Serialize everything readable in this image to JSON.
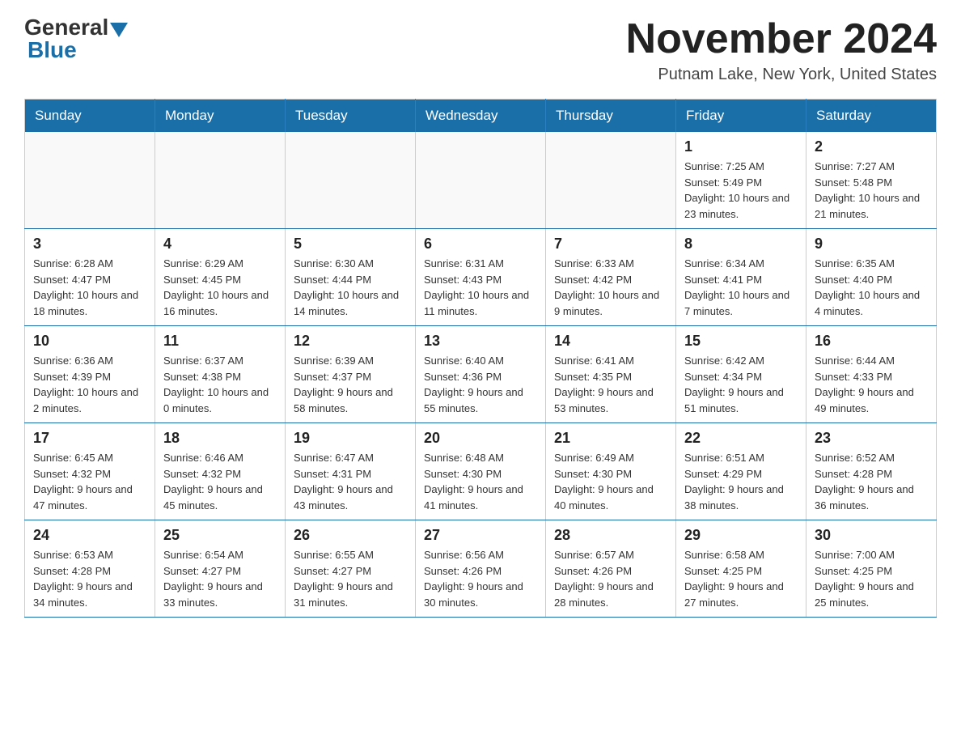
{
  "header": {
    "logo_general": "General",
    "logo_blue": "Blue",
    "month_title": "November 2024",
    "location": "Putnam Lake, New York, United States"
  },
  "weekdays": [
    "Sunday",
    "Monday",
    "Tuesday",
    "Wednesday",
    "Thursday",
    "Friday",
    "Saturday"
  ],
  "weeks": [
    [
      {
        "day": "",
        "info": ""
      },
      {
        "day": "",
        "info": ""
      },
      {
        "day": "",
        "info": ""
      },
      {
        "day": "",
        "info": ""
      },
      {
        "day": "",
        "info": ""
      },
      {
        "day": "1",
        "info": "Sunrise: 7:25 AM\nSunset: 5:49 PM\nDaylight: 10 hours and 23 minutes."
      },
      {
        "day": "2",
        "info": "Sunrise: 7:27 AM\nSunset: 5:48 PM\nDaylight: 10 hours and 21 minutes."
      }
    ],
    [
      {
        "day": "3",
        "info": "Sunrise: 6:28 AM\nSunset: 4:47 PM\nDaylight: 10 hours and 18 minutes."
      },
      {
        "day": "4",
        "info": "Sunrise: 6:29 AM\nSunset: 4:45 PM\nDaylight: 10 hours and 16 minutes."
      },
      {
        "day": "5",
        "info": "Sunrise: 6:30 AM\nSunset: 4:44 PM\nDaylight: 10 hours and 14 minutes."
      },
      {
        "day": "6",
        "info": "Sunrise: 6:31 AM\nSunset: 4:43 PM\nDaylight: 10 hours and 11 minutes."
      },
      {
        "day": "7",
        "info": "Sunrise: 6:33 AM\nSunset: 4:42 PM\nDaylight: 10 hours and 9 minutes."
      },
      {
        "day": "8",
        "info": "Sunrise: 6:34 AM\nSunset: 4:41 PM\nDaylight: 10 hours and 7 minutes."
      },
      {
        "day": "9",
        "info": "Sunrise: 6:35 AM\nSunset: 4:40 PM\nDaylight: 10 hours and 4 minutes."
      }
    ],
    [
      {
        "day": "10",
        "info": "Sunrise: 6:36 AM\nSunset: 4:39 PM\nDaylight: 10 hours and 2 minutes."
      },
      {
        "day": "11",
        "info": "Sunrise: 6:37 AM\nSunset: 4:38 PM\nDaylight: 10 hours and 0 minutes."
      },
      {
        "day": "12",
        "info": "Sunrise: 6:39 AM\nSunset: 4:37 PM\nDaylight: 9 hours and 58 minutes."
      },
      {
        "day": "13",
        "info": "Sunrise: 6:40 AM\nSunset: 4:36 PM\nDaylight: 9 hours and 55 minutes."
      },
      {
        "day": "14",
        "info": "Sunrise: 6:41 AM\nSunset: 4:35 PM\nDaylight: 9 hours and 53 minutes."
      },
      {
        "day": "15",
        "info": "Sunrise: 6:42 AM\nSunset: 4:34 PM\nDaylight: 9 hours and 51 minutes."
      },
      {
        "day": "16",
        "info": "Sunrise: 6:44 AM\nSunset: 4:33 PM\nDaylight: 9 hours and 49 minutes."
      }
    ],
    [
      {
        "day": "17",
        "info": "Sunrise: 6:45 AM\nSunset: 4:32 PM\nDaylight: 9 hours and 47 minutes."
      },
      {
        "day": "18",
        "info": "Sunrise: 6:46 AM\nSunset: 4:32 PM\nDaylight: 9 hours and 45 minutes."
      },
      {
        "day": "19",
        "info": "Sunrise: 6:47 AM\nSunset: 4:31 PM\nDaylight: 9 hours and 43 minutes."
      },
      {
        "day": "20",
        "info": "Sunrise: 6:48 AM\nSunset: 4:30 PM\nDaylight: 9 hours and 41 minutes."
      },
      {
        "day": "21",
        "info": "Sunrise: 6:49 AM\nSunset: 4:30 PM\nDaylight: 9 hours and 40 minutes."
      },
      {
        "day": "22",
        "info": "Sunrise: 6:51 AM\nSunset: 4:29 PM\nDaylight: 9 hours and 38 minutes."
      },
      {
        "day": "23",
        "info": "Sunrise: 6:52 AM\nSunset: 4:28 PM\nDaylight: 9 hours and 36 minutes."
      }
    ],
    [
      {
        "day": "24",
        "info": "Sunrise: 6:53 AM\nSunset: 4:28 PM\nDaylight: 9 hours and 34 minutes."
      },
      {
        "day": "25",
        "info": "Sunrise: 6:54 AM\nSunset: 4:27 PM\nDaylight: 9 hours and 33 minutes."
      },
      {
        "day": "26",
        "info": "Sunrise: 6:55 AM\nSunset: 4:27 PM\nDaylight: 9 hours and 31 minutes."
      },
      {
        "day": "27",
        "info": "Sunrise: 6:56 AM\nSunset: 4:26 PM\nDaylight: 9 hours and 30 minutes."
      },
      {
        "day": "28",
        "info": "Sunrise: 6:57 AM\nSunset: 4:26 PM\nDaylight: 9 hours and 28 minutes."
      },
      {
        "day": "29",
        "info": "Sunrise: 6:58 AM\nSunset: 4:25 PM\nDaylight: 9 hours and 27 minutes."
      },
      {
        "day": "30",
        "info": "Sunrise: 7:00 AM\nSunset: 4:25 PM\nDaylight: 9 hours and 25 minutes."
      }
    ]
  ]
}
